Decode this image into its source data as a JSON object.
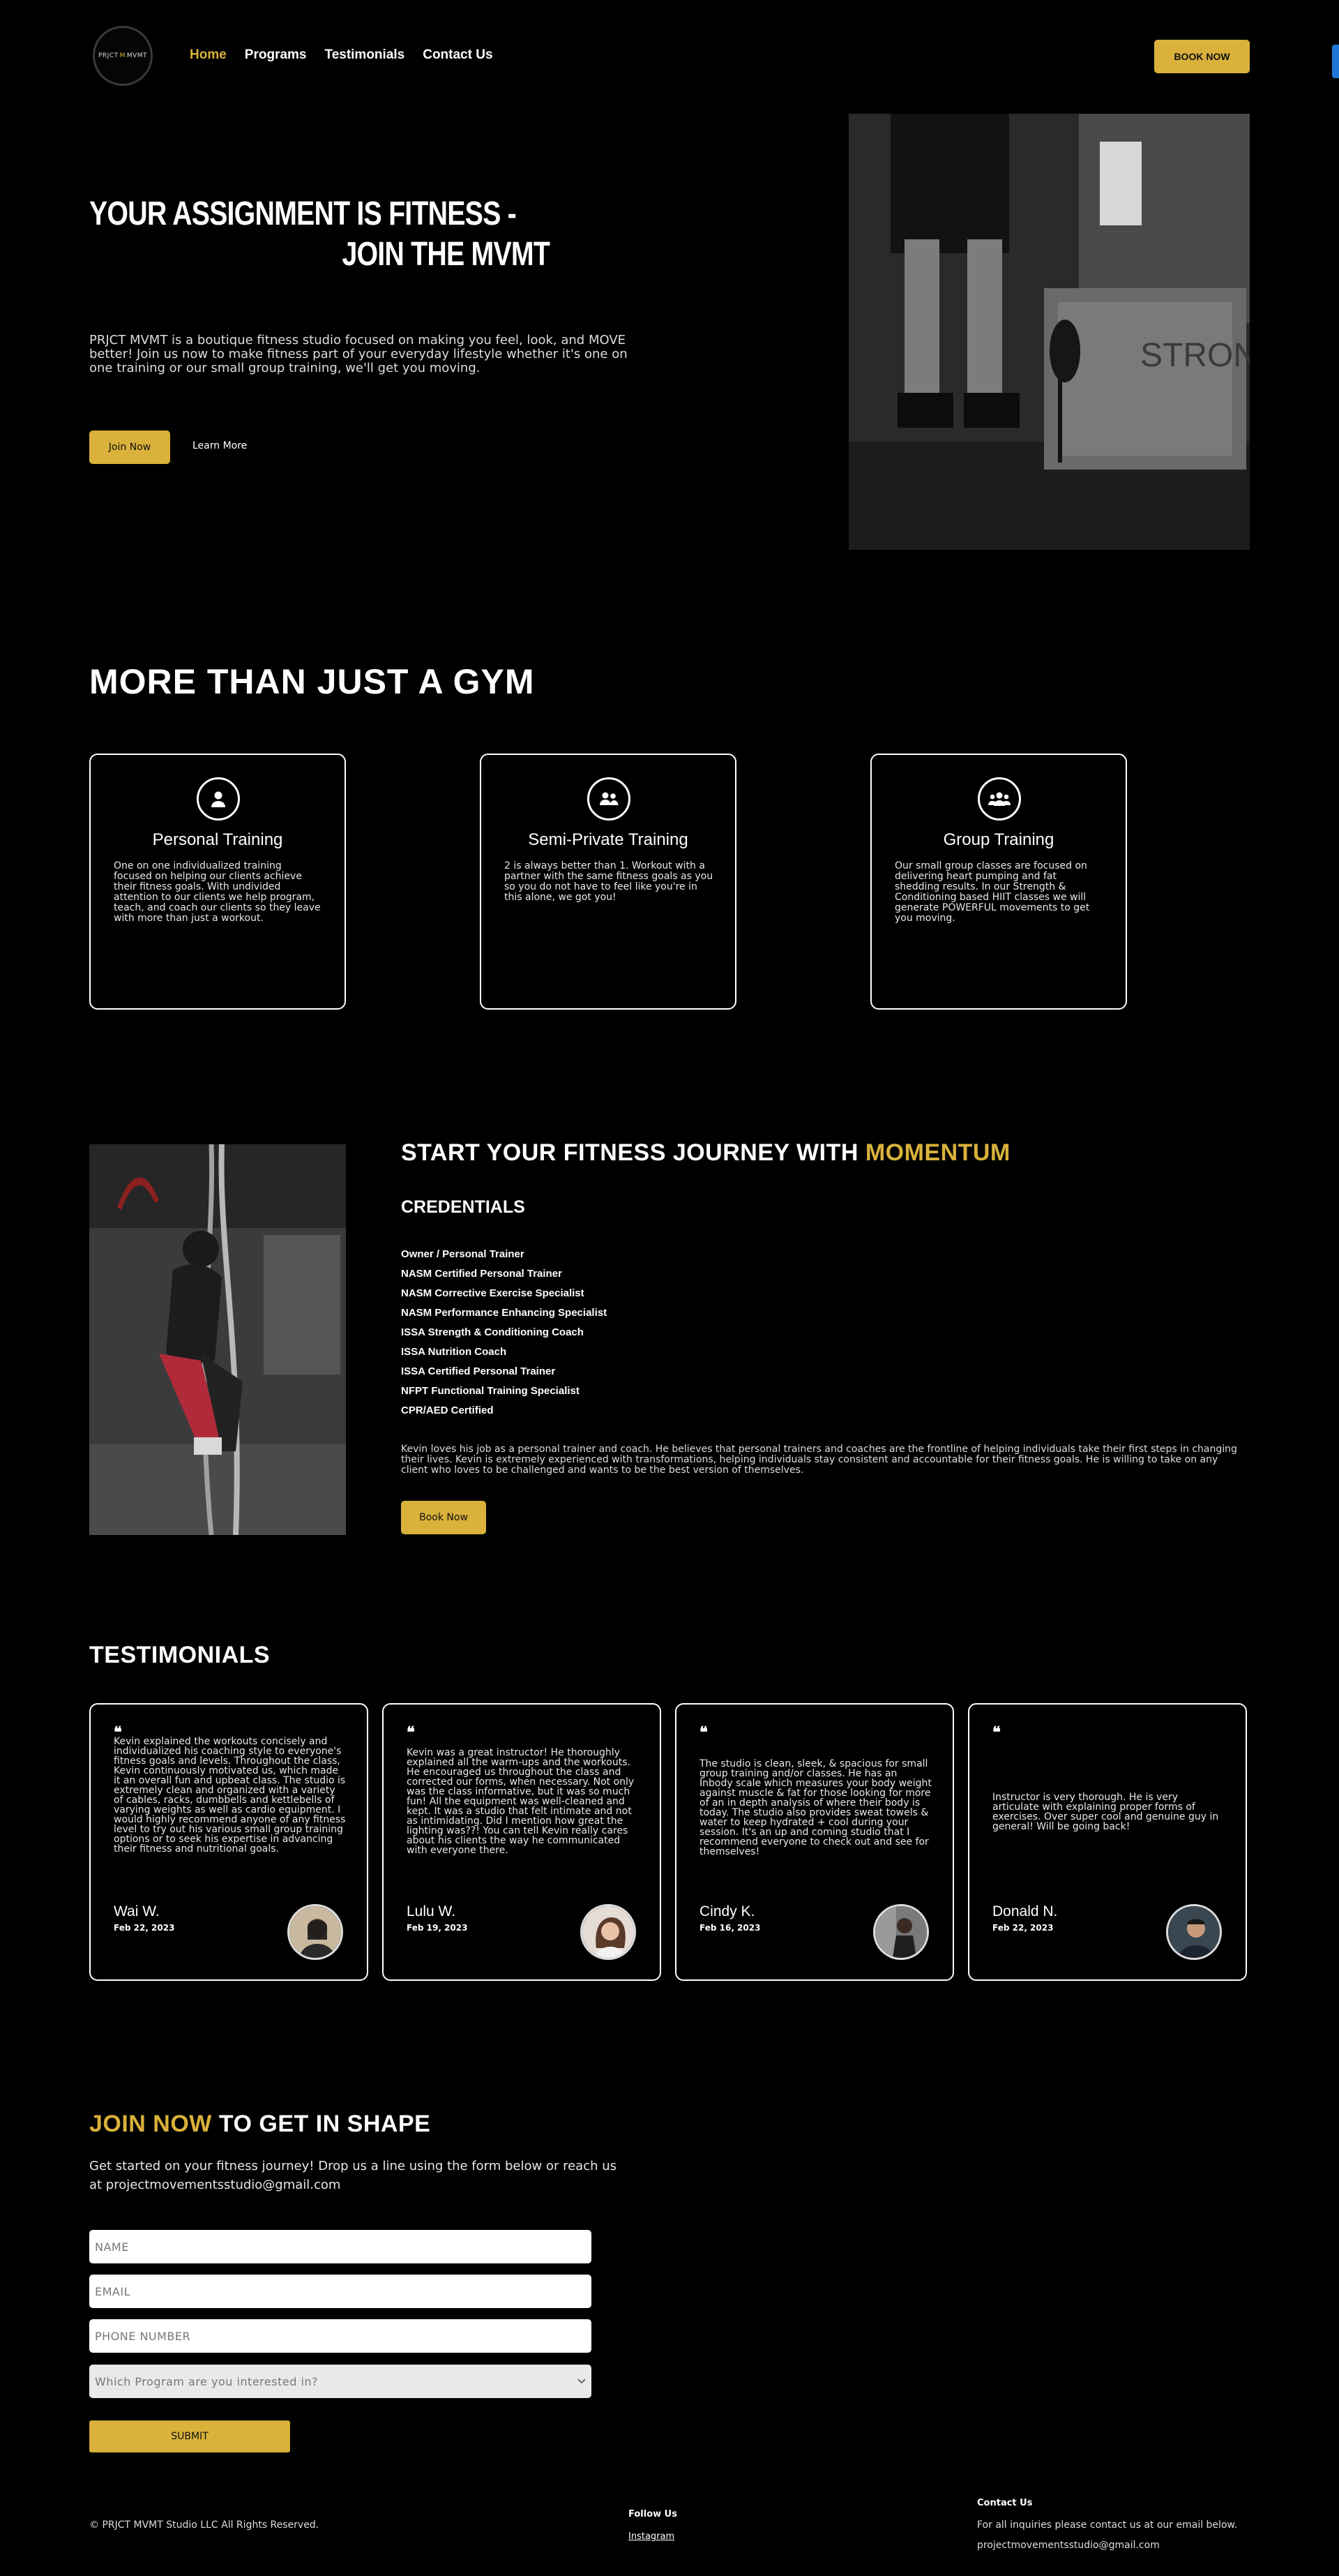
{
  "colors": {
    "accent": "#d9b13b",
    "background": "#000000",
    "text": "#ffffff"
  },
  "header": {
    "logo_left": "PRJCT",
    "logo_mid": "M",
    "logo_right": "MVMT",
    "nav": [
      "Home",
      "Programs",
      "Testimonials",
      "Contact Us"
    ],
    "active_nav": "Home",
    "book_label": "BOOK NOW"
  },
  "hero": {
    "title_line1": "YOUR ASSIGNMENT IS FITNESS -",
    "title_line2": "JOIN THE MVMT",
    "description": "PRJCT MVMT is a boutique fitness studio focused on making you feel, look, and MOVE better! Join us now to make fitness part of your everyday lifestyle whether it's one on one training or our small group training, we'll get you moving.",
    "join_label": "Join Now",
    "learn_label": "Learn More",
    "image_text": "STRON"
  },
  "programs": {
    "heading": "MORE THAN JUST A GYM",
    "cards": [
      {
        "icon": "person-icon",
        "title": "Personal Training",
        "text": "One on one individualized training focused on helping our clients achieve their fitness goals. With undivided attention to our clients we help program, teach, and coach our clients so they leave with more than just a workout."
      },
      {
        "icon": "two-people-icon",
        "title": "Semi-Private Training",
        "text": "2 is always better than 1. Workout with a partner with the same fitness goals as you so you do not have to feel like you're in this alone, we got you!"
      },
      {
        "icon": "group-icon",
        "title": "Group Training",
        "text": "Our small group classes are focused on delivering heart pumping and fat shedding results. In our Strength & Conditioning based HIIT classes we will generate POWERFUL movements to get you moving."
      }
    ]
  },
  "journey": {
    "title_prefix": "START YOUR FITNESS JOURNEY WITH ",
    "title_highlight": "MOMENTUM",
    "credentials_heading": "CREDENTIALS",
    "credentials": [
      "Owner / Personal Trainer",
      "NASM Certified Personal Trainer",
      "NASM Corrective Exercise Specialist",
      "NASM Performance Enhancing Specialist",
      "ISSA Strength & Conditioning Coach",
      "ISSA Nutrition Coach",
      "ISSA Certified Personal Trainer",
      "NFPT Functional Training Specialist",
      "CPR/AED Certified"
    ],
    "bio": "Kevin loves his job as a personal trainer and coach. He believes that personal trainers and coaches are the frontline of helping individuals take their first steps in changing their lives. Kevin is extremely experienced with transformations, helping individuals stay consistent and accountable for their fitness goals. He is willing to take on any client who loves to be challenged and wants to be the best version of themselves.",
    "book_label": "Book Now"
  },
  "testimonials": {
    "heading": "TESTIMONIALS",
    "quote_mark": "❝",
    "items": [
      {
        "text": "Kevin explained the workouts concisely and individualized his coaching style to everyone's fitness goals and levels. Throughout the class, Kevin continuously motivated us, which made it an overall fun and upbeat class. The studio is extremely clean and organized with a variety of cables, racks, dumbbells and kettlebells of varying weights as well as cardio equipment. I would highly recommend anyone of any fitness level to try out his various small group training options or to seek his expertise in advancing their fitness and nutritional goals.",
        "name": "Wai W.",
        "date": "Feb 22, 2023"
      },
      {
        "text": "Kevin was a great instructor! He thoroughly explained all the warm-ups and the workouts. He encouraged us throughout the class and corrected our forms, when necessary. Not only was the class informative, but it was so much fun! All the equipment was well-cleaned and kept. It was a studio that felt intimate and not as intimidating. Did I mention how great the lighting was??! You can tell Kevin really cares about his clients the way he communicated with everyone there.",
        "name": "Lulu W.",
        "date": "Feb 19, 2023"
      },
      {
        "text": "The studio is clean, sleek, & spacious for small group training and/or classes. He has an Inbody scale which measures your body weight against muscle & fat for those looking for more of an in depth analysis of where their body is today. The studio also provides sweat towels & water to keep hydrated + cool during your session. It's an up and coming studio that I recommend everyone to check out and see for themselves!",
        "name": "Cindy K.",
        "date": "Feb 16, 2023"
      },
      {
        "text": "Instructor is very thorough. He is very articulate with explaining proper forms of exercises. Over super cool and genuine guy in general! Will be going back!",
        "name": "Donald N.",
        "date": "Feb 22, 2023"
      }
    ]
  },
  "contact": {
    "heading_highlight": "JOIN NOW",
    "heading_rest": " TO GET IN SHAPE",
    "description": "Get started on your fitness journey! Drop us a line using the form below or reach us at projectmovementsstudio@gmail.com",
    "name_placeholder": "NAME",
    "email_placeholder": "EMAIL",
    "phone_placeholder": "PHONE NUMBER",
    "program_placeholder": "Which Program are you interested in?",
    "submit_label": "SUBMIT"
  },
  "footer": {
    "copyright": "© PRJCT MVMT Studio LLC All Rights Reserved.",
    "follow_heading": "Follow Us",
    "instagram": "Instagram",
    "contact_heading": "Contact Us",
    "contact_text": "For all inquiries please contact us at our email below.",
    "contact_email": "projectmovementsstudio@gmail.com"
  }
}
